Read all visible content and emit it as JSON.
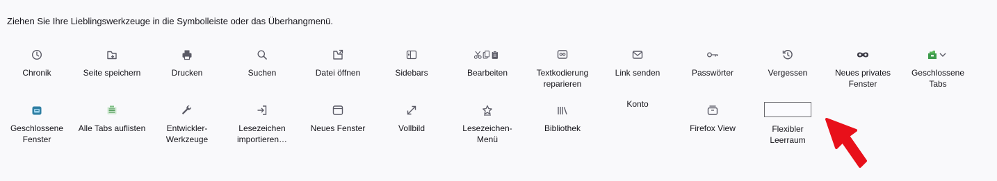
{
  "instructions": "Ziehen Sie Ihre Lieblingswerkzeuge in die Symbolleiste oder das Überhangmenü.",
  "row1": [
    {
      "label": "Chronik",
      "icon": "clock-icon"
    },
    {
      "label": "Seite speichern",
      "icon": "save-page-icon"
    },
    {
      "label": "Drucken",
      "icon": "printer-icon"
    },
    {
      "label": "Suchen",
      "icon": "search-icon"
    },
    {
      "label": "Datei öffnen",
      "icon": "open-file-icon"
    },
    {
      "label": "Sidebars",
      "icon": "sidebar-icon"
    },
    {
      "label": "Bearbeiten",
      "icon": "cut-copy-paste-icon"
    },
    {
      "label": "Textkodierung reparieren",
      "icon": "text-encoding-icon"
    },
    {
      "label": "Link senden",
      "icon": "envelope-icon"
    },
    {
      "label": "Passwörter",
      "icon": "key-icon"
    },
    {
      "label": "Vergessen",
      "icon": "forget-icon"
    },
    {
      "label": "Neues privates Fenster",
      "icon": "private-mask-icon"
    },
    {
      "label": "Geschlossene Tabs",
      "icon": "closed-tabs-icon"
    }
  ],
  "row2": [
    {
      "label": "Geschlossene Fenster",
      "icon": "closed-windows-icon"
    },
    {
      "label": "Alle Tabs auflisten",
      "icon": "list-tabs-icon"
    },
    {
      "label": "Entwickler-Werkzeuge",
      "icon": "wrench-icon"
    },
    {
      "label": "Lesezeichen importieren…",
      "icon": "import-icon"
    },
    {
      "label": "Neues Fenster",
      "icon": "new-window-icon"
    },
    {
      "label": "Vollbild",
      "icon": "fullscreen-icon"
    },
    {
      "label": "Lesezeichen-Menü",
      "icon": "bookmark-star-icon"
    },
    {
      "label": "Bibliothek",
      "icon": "library-icon"
    },
    {
      "label": "Konto",
      "icon": ""
    },
    {
      "label": "Firefox View",
      "icon": "firefox-view-icon"
    },
    {
      "label": "Flexibler Leerraum",
      "icon": "flexible-space-box"
    }
  ],
  "colors": {
    "background": "#f9f9fb",
    "text": "#15141a",
    "icon": "#5b5b66",
    "arrow": "#e8101a"
  }
}
